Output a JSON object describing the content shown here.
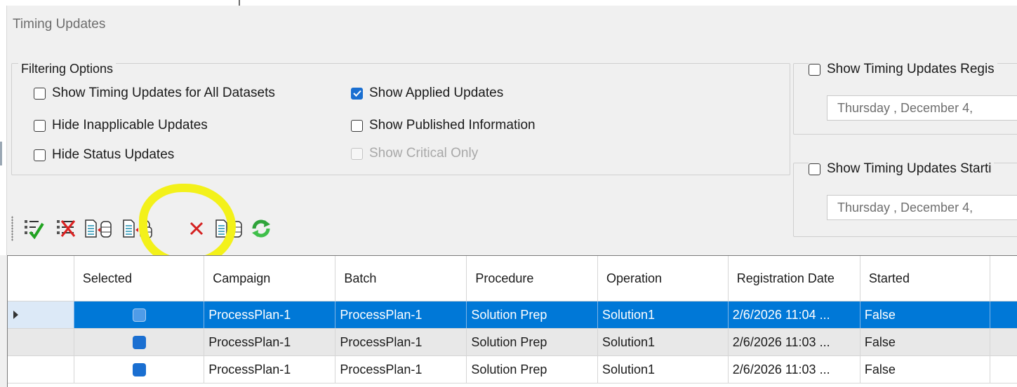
{
  "window": {
    "title": "Timing Updates"
  },
  "filtering": {
    "legend": "Filtering Options",
    "options": [
      {
        "label": "Show Timing Updates for All Datasets",
        "checked": false,
        "enabled": true
      },
      {
        "label": "Hide Inapplicable Updates",
        "checked": false,
        "enabled": true
      },
      {
        "label": "Hide Status Updates",
        "checked": false,
        "enabled": true
      },
      {
        "label": "Show Applied Updates",
        "checked": true,
        "enabled": true
      },
      {
        "label": "Show Published Information",
        "checked": false,
        "enabled": true
      },
      {
        "label": "Show Critical Only",
        "checked": false,
        "enabled": false
      }
    ]
  },
  "right": {
    "registered": {
      "label": "Show Timing Updates Regis",
      "date": "Thursday  , December  4,"
    },
    "starting": {
      "label": "Show Timing Updates Starti",
      "date": "Thursday  , December  4,"
    }
  },
  "toolbar": {
    "icons": [
      "select-all-icon",
      "deselect-all-icon",
      "load-from-database-icon",
      "load-scheduled-icon",
      "delete-icon",
      "save-to-database-icon",
      "refresh-icon"
    ],
    "highlight_color": "#f3f11a"
  },
  "grid": {
    "columns": [
      "Selected",
      "Campaign",
      "Batch",
      "Procedure",
      "Operation",
      "Registration Date",
      "Started"
    ],
    "rows": [
      {
        "selected": true,
        "campaign": "ProcessPlan-1",
        "batch": "ProcessPlan-1",
        "procedure": "Solution Prep",
        "operation": "Solution1",
        "registration_date": "2/6/2026 11:04 ...",
        "started": "False"
      },
      {
        "selected": true,
        "campaign": "ProcessPlan-1",
        "batch": "ProcessPlan-1",
        "procedure": "Solution Prep",
        "operation": "Solution1",
        "registration_date": "2/6/2026 11:03 ...",
        "started": "False"
      },
      {
        "selected": true,
        "campaign": "ProcessPlan-1",
        "batch": "ProcessPlan-1",
        "procedure": "Solution Prep",
        "operation": "Solution1",
        "registration_date": "2/6/2026 11:03 ...",
        "started": "False"
      }
    ],
    "selection_color": "#0078d7"
  }
}
